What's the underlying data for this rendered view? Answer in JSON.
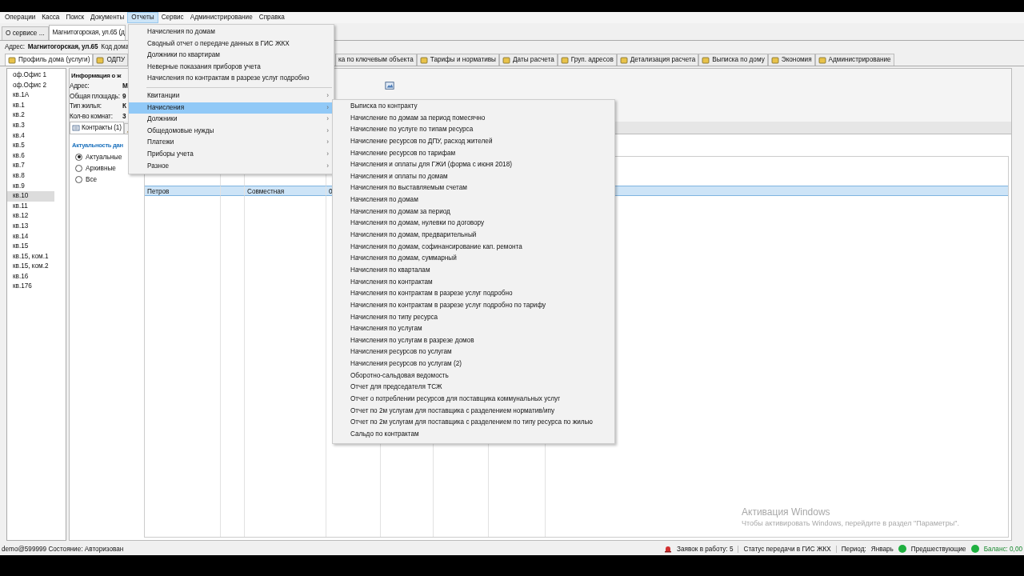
{
  "menubar": [
    {
      "label": "Операции",
      "selected": false
    },
    {
      "label": "Касса",
      "selected": false
    },
    {
      "label": "Поиск",
      "selected": false
    },
    {
      "label": "Документы",
      "selected": false
    },
    {
      "label": "Отчеты",
      "selected": true
    },
    {
      "label": "Сервис",
      "selected": false
    },
    {
      "label": "Администрирование",
      "selected": false
    },
    {
      "label": "Справка",
      "selected": false
    }
  ],
  "doc_tabs": [
    {
      "label": "О сервисе ...",
      "selected": false
    },
    {
      "label": "Магнитогорская, ул.65 (д",
      "selected": true
    }
  ],
  "address": {
    "label": "Адрес:",
    "value": "Магнитогорская, ул.65",
    "code_label": "Код дома"
  },
  "house_tabs": [
    {
      "label": "Профиль дома (услуги)",
      "selected": true,
      "kind": "icon"
    },
    {
      "label": "ОДПУ",
      "selected": false,
      "kind": "icon"
    },
    {
      "label": "ка по ключевым объекта",
      "selected": false,
      "kind": "cut"
    },
    {
      "label": "Тарифы и нормативы",
      "selected": false,
      "kind": "icon"
    },
    {
      "label": "Даты расчета",
      "selected": false,
      "kind": "icon"
    },
    {
      "label": "Груп. адресов",
      "selected": false,
      "kind": "icon"
    },
    {
      "label": "Детализация расчета",
      "selected": false,
      "kind": "icon"
    },
    {
      "label": "Выписка по дому",
      "selected": false,
      "kind": "icon"
    },
    {
      "label": "Экономия",
      "selected": false,
      "kind": "icon"
    },
    {
      "label": "Администрирование",
      "selected": false,
      "kind": "icon"
    }
  ],
  "apartments": [
    {
      "label": "оф.Офис 1",
      "selected": false
    },
    {
      "label": "оф.Офис 2",
      "selected": false
    },
    {
      "label": "кв.1А",
      "selected": false
    },
    {
      "label": "кв.1",
      "selected": false
    },
    {
      "label": "кв.2",
      "selected": false
    },
    {
      "label": "кв.3",
      "selected": false
    },
    {
      "label": "кв.4",
      "selected": false
    },
    {
      "label": "кв.5",
      "selected": false
    },
    {
      "label": "кв.6",
      "selected": false
    },
    {
      "label": "кв.7",
      "selected": false
    },
    {
      "label": "кв.8",
      "selected": false
    },
    {
      "label": "кв.9",
      "selected": false
    },
    {
      "label": "кв.10",
      "selected": true
    },
    {
      "label": "кв.11",
      "selected": false
    },
    {
      "label": "кв.12",
      "selected": false
    },
    {
      "label": "кв.13",
      "selected": false
    },
    {
      "label": "кв.14",
      "selected": false
    },
    {
      "label": "кв.15",
      "selected": false
    },
    {
      "label": "кв.15, ком.1",
      "selected": false
    },
    {
      "label": "кв.15, ком.2",
      "selected": false
    },
    {
      "label": "кв.16",
      "selected": false
    },
    {
      "label": "кв.176",
      "selected": false
    }
  ],
  "info": {
    "title": "Информация о ж",
    "rows": [
      {
        "label": "Адрес:",
        "value": "М"
      },
      {
        "label": "Общая площадь:",
        "value": "9"
      },
      {
        "label": "Тип жилья:",
        "value": "К"
      },
      {
        "label": "Кол-во комнат:",
        "value": "3"
      }
    ]
  },
  "contract_tabs": [
    {
      "label": "Контракты (1)",
      "selected": true
    }
  ],
  "filter": {
    "title": "Актуальность дан",
    "options": [
      {
        "label": "Актуальные",
        "selected": true
      },
      {
        "label": "Архивные",
        "selected": false
      },
      {
        "label": "Все",
        "selected": false
      }
    ]
  },
  "table": {
    "rows": [
      {
        "selected": true,
        "column_1": "Петров",
        "column_3": "Совместная",
        "column_4": "0"
      }
    ]
  },
  "menu": {
    "items": [
      {
        "label": "Начисления по домам",
        "kind": "item",
        "selected": false
      },
      {
        "label": "Сводный отчет о передаче данных в ГИС ЖКХ",
        "kind": "item",
        "selected": false
      },
      {
        "label": "Должники по квартирам",
        "kind": "item",
        "selected": false
      },
      {
        "label": "Неверные показания приборов учета",
        "kind": "item",
        "selected": false
      },
      {
        "label": "Начисления по контрактам в разрезе услуг подробно",
        "kind": "item",
        "selected": false
      },
      {
        "kind": "separator"
      },
      {
        "label": "Квитанции",
        "kind": "submenu",
        "selected": false
      },
      {
        "label": "Начисления",
        "kind": "submenu",
        "selected": true
      },
      {
        "label": "Должники",
        "kind": "submenu",
        "selected": false
      },
      {
        "label": "Общедомовые нужды",
        "kind": "submenu",
        "selected": false
      },
      {
        "label": "Платежи",
        "kind": "submenu",
        "selected": false
      },
      {
        "label": "Приборы учета",
        "kind": "submenu",
        "selected": false
      },
      {
        "label": "Разное",
        "kind": "submenu",
        "selected": false
      }
    ],
    "arrow": "›"
  },
  "submenu": {
    "items": [
      "Выписка по контракту",
      "Начисление по домам за период помесячно",
      "Начисление по услуге по типам ресурса",
      "Начисление ресурсов по ДПУ, расход жителей",
      "Начисление ресурсов по тарифам",
      "Начисления и оплаты для ГЖИ (форма с июня 2018)",
      "Начисления и оплаты по домам",
      "Начисления по выставляемым счетам",
      "Начисления по домам",
      "Начисления по домам за период",
      "Начисления по домам, нулевки по договору",
      "Начисления по домам, предварительный",
      "Начисления по домам, софинансирование кап. ремонта",
      "Начисления по домам, суммарный",
      "Начисления по кварталам",
      "Начисления по контрактам",
      "Начисления по контрактам в разрезе услуг подробно",
      "Начисления по контрактам в разрезе услуг подробно по тарифу",
      "Начисления по типу ресурса",
      "Начисления по услугам",
      "Начисления по услугам в разрезе домов",
      "Начисления ресурсов по услугам",
      "Начисления ресурсов по услугам (2)",
      "Оборотно-сальдовая ведомость",
      "Отчет для председателя ТСЖ",
      "Отчет о потреблении ресурсов для поставщика коммунальных услуг",
      "Отчет по 2м услугам для поставщика с разделением норматив/ипу",
      "Отчет по 2м услугам для поставщика с разделением по типу ресурса по жилью",
      "Сальдо по контрактам"
    ]
  },
  "status_bar": {
    "user": "demo@599999 Состояние: Авторизован",
    "requests": "Заявок в работу: 5",
    "gis": "Статус передачи в ГИС ЖКХ",
    "period_label": "Период:",
    "period": "Январь",
    "indicators": [
      {
        "color": "#1fb040",
        "label": "Предшествующие",
        "kind": "text"
      },
      {
        "color": "#1fb040",
        "label": "Баланс: 0,00",
        "kind": "balance"
      }
    ]
  },
  "activation": {
    "title": "Активация Windows",
    "text": "Чтобы активировать Windows, перейдите в раздел \"Параметры\"."
  }
}
